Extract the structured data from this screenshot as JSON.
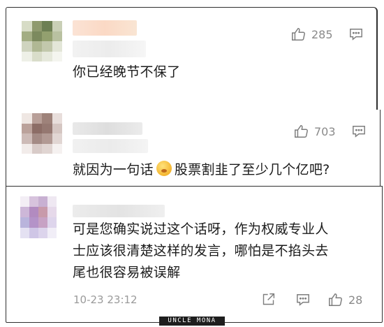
{
  "comments": [
    {
      "text": "你已经晚节不保了",
      "likes": "285"
    },
    {
      "text_before": "就因为一句话",
      "text_after": "股票割韭了至少几个亿吧?",
      "likes": "703"
    },
    {
      "lines": [
        "可是您确实说过这个话呀，作为权威专业人",
        "士应该很清楚这样的发言，哪怕是不掐头去",
        "尾也很容易被误解"
      ],
      "date": "10-23 23:12",
      "likes": "28"
    }
  ],
  "icons": {
    "like": "thumbs-up-icon",
    "reply": "comment-icon",
    "share": "share-icon",
    "emoji": "nervous-face-emoji"
  },
  "watermark": "UNCLE MONA"
}
